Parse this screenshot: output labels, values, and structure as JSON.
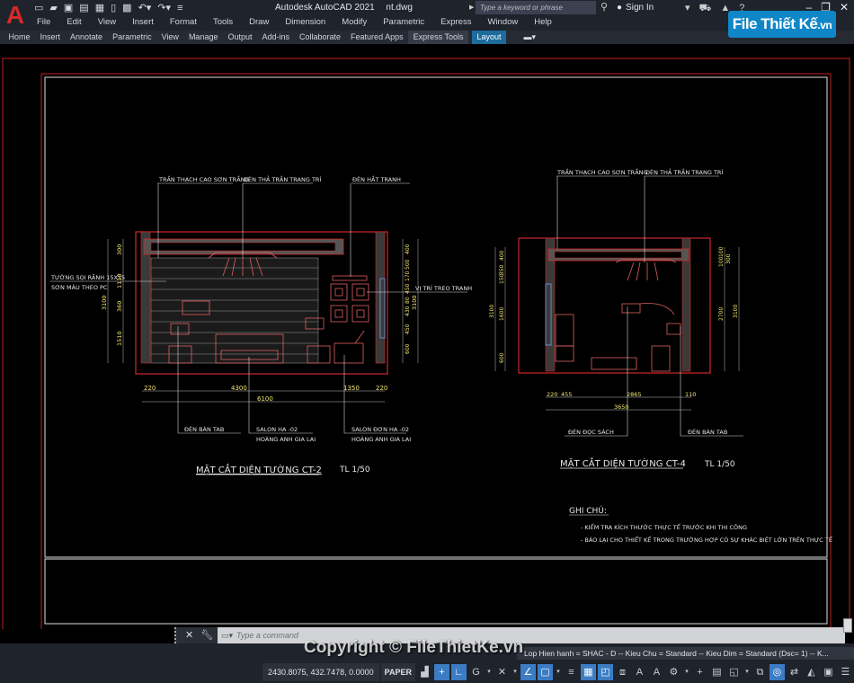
{
  "titlebar": {
    "app_name": "Autodesk AutoCAD 2021",
    "file_name": "nt.dwg",
    "search_placeholder": "Type a keyword or phrase",
    "sign_in": "Sign In",
    "quick_access_icons": [
      "new-icon",
      "open-icon",
      "save-icon",
      "save-as-icon",
      "plot-icon",
      "publish-icon",
      "print-icon",
      "undo-icon",
      "redo-icon",
      "customize-icon"
    ]
  },
  "menubar": [
    "File",
    "Edit",
    "View",
    "Insert",
    "Format",
    "Tools",
    "Draw",
    "Dimension",
    "Modify",
    "Parametric",
    "Express",
    "Window",
    "Help"
  ],
  "ribbon_tabs": [
    "Home",
    "Insert",
    "Annotate",
    "Parametric",
    "View",
    "Manage",
    "Output",
    "Add-ins",
    "Collaborate",
    "Featured Apps",
    "Express Tools",
    "Layout"
  ],
  "active_tab": "Layout",
  "watermark": {
    "logo": "File Thiết Kế",
    "logo_suffix": ".vn",
    "copyright": "Copyright © FileThietKe.vn"
  },
  "drawing": {
    "ct2": {
      "title": "MẶT CẮT DIỆN TƯỜNG CT-2",
      "scale": "TL 1/50",
      "labels": {
        "ceiling": "TRẦN THẠCH CAO SƠN TRẮNG",
        "pendant": "ĐÈN THẢ TRẦN TRANG TRÍ",
        "picture_light": "ĐÈN HẮT TRANH",
        "wall1": "TƯỜNG SỌI RÃNH 15X15",
        "wall2": "SƠN MÀU THEO PC",
        "hang": "VỊ TRÍ TREO TRANH",
        "lamp": "ĐÈN BÀN TAB",
        "sofa1": "SALON HA -02",
        "sofa2": "HOÀNG ANH GIA LAI",
        "chair1": "SALON ĐƠN HA -02",
        "chair2": "HOÀNG ANH GIA LAI"
      },
      "dims_bottom": [
        "220",
        "4300",
        "1350",
        "220"
      ],
      "dim_total": "6100",
      "dims_left": [
        "300",
        "80",
        "1110",
        "360",
        "1510"
      ],
      "dim_left_total": "3100",
      "dims_right": [
        "400",
        "500",
        "170",
        "450",
        "80",
        "430",
        "450",
        "600"
      ],
      "dim_right_total": "3100"
    },
    "ct4": {
      "title": "MẶT CẮT DIỆN TƯỜNG CT-4",
      "scale": "TL 1/50",
      "labels": {
        "ceiling": "TRẦN THẠCH CAO SƠN TRẮNG",
        "pendant": "ĐÈN THẢ TRẦN TRANG TRÍ",
        "reading_lamp": "ĐÈN ĐỌC SÁCH",
        "lamp": "ĐÈN BÀN TAB"
      },
      "dims_bottom": [
        "220",
        "455",
        "2865",
        "110"
      ],
      "dim_total": "3650",
      "dims_left": [
        "400",
        "350",
        "150",
        "1600",
        "600"
      ],
      "dim_left_total": "3100",
      "dims_right": [
        "100",
        "100",
        "2700"
      ],
      "dim_right_mid": "300",
      "dim_right_total": "3100"
    },
    "notes": {
      "title": "GHI CHÚ:",
      "items": [
        "- KIỂM TRA KÍCH THƯỚC THỰC TẾ TRƯỚC KHI THI CÔNG",
        "- BÁO LẠI CHO THIẾT KẾ TRONG TRƯỜNG HỢP CÓ SỰ KHÁC BIỆT LỚN TRÊN THỰC TẾ"
      ]
    }
  },
  "command_line": {
    "placeholder": "Type a command"
  },
  "layer_info": "Lop Hien hanh = SHAC - D -- Kieu Chu = Standard -- Kieu Dim = Standard (Dsc= 1) -- K...",
  "statusbar": {
    "coordinates": "2430.8075, 432.7478, 0.0000",
    "space": "PAPER"
  }
}
